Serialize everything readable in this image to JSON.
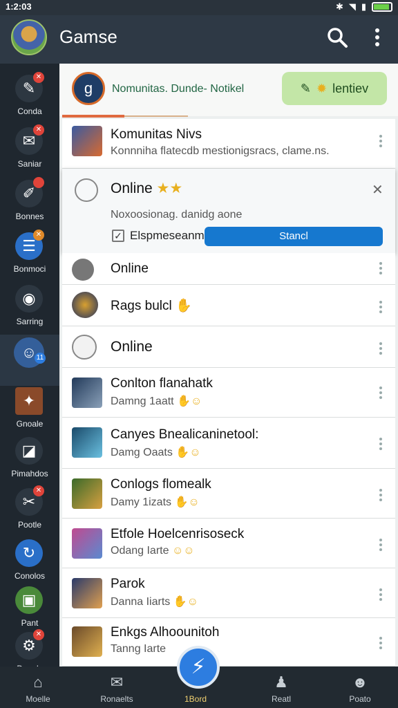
{
  "status": {
    "time": "1:2:03"
  },
  "app": {
    "title": "Gamse"
  },
  "sidebar": {
    "items": [
      {
        "label": "Conda",
        "icon": "chat-icon",
        "bg": "#2d3741"
      },
      {
        "label": "Saniar",
        "icon": "mail-icon",
        "bg": "#2d3741"
      },
      {
        "label": "Bonnes",
        "icon": "edit-icon",
        "bg": "#2d3741"
      },
      {
        "label": "Bonmoci",
        "icon": "list-icon",
        "bg": "#2a6fc8"
      },
      {
        "label": "Sarring",
        "icon": "settings-icon",
        "bg": "#2d3741"
      },
      {
        "label": "",
        "icon": "avatar-icon",
        "bg": "#345f9a"
      },
      {
        "label": "Gnoale",
        "icon": "game-icon",
        "bg": "#8a4a2a"
      },
      {
        "label": "Pimahdos",
        "icon": "bag-icon",
        "bg": "#2d3741"
      },
      {
        "label": "Pootle",
        "icon": "tools-icon",
        "bg": "#2d3741"
      },
      {
        "label": "Conolos",
        "icon": "refresh-icon",
        "bg": "#2a6fc8"
      },
      {
        "label": "Pant",
        "icon": "cube-icon",
        "bg": "#4a8a3a"
      },
      {
        "label": "Doenls",
        "icon": "gear-icon",
        "bg": "#2d3741"
      }
    ]
  },
  "topcard": {
    "text": "Nomunitas. Dunde-  Notikel",
    "button": "lentiev"
  },
  "rows": [
    {
      "title": "Komunitas Nivs",
      "sub": "Konnniha flatecdb mestionigsracs, clame.ns."
    },
    {
      "title": "Online",
      "sub": ""
    },
    {
      "title": "Rags bulcl",
      "sub": ""
    },
    {
      "title": "Online",
      "sub": ""
    },
    {
      "title": "Conlton flanahatk",
      "sub": "Damng 1aatt"
    },
    {
      "title": "Canyes Bnealicaninetool:",
      "sub": "Damg Oaats"
    },
    {
      "title": "Conlogs flomealk",
      "sub": "Damy 1izats"
    },
    {
      "title": "Etfole Hoelcenrisoseck",
      "sub": "Odang Iarte"
    },
    {
      "title": "Parok",
      "sub": "Danna Iiarts"
    },
    {
      "title": "Enkgs Alhoounitoh",
      "sub": "Tanng Iarte"
    }
  ],
  "popup": {
    "title": "Online",
    "description": "Noxoosionag. danidg aone",
    "checkbox_label": "Elspmeseanme",
    "button": "Stancl"
  },
  "bottomnav": {
    "items": [
      "Moelle",
      "Ronaelts",
      "1Bord",
      "Reatl",
      "Poato"
    ]
  }
}
